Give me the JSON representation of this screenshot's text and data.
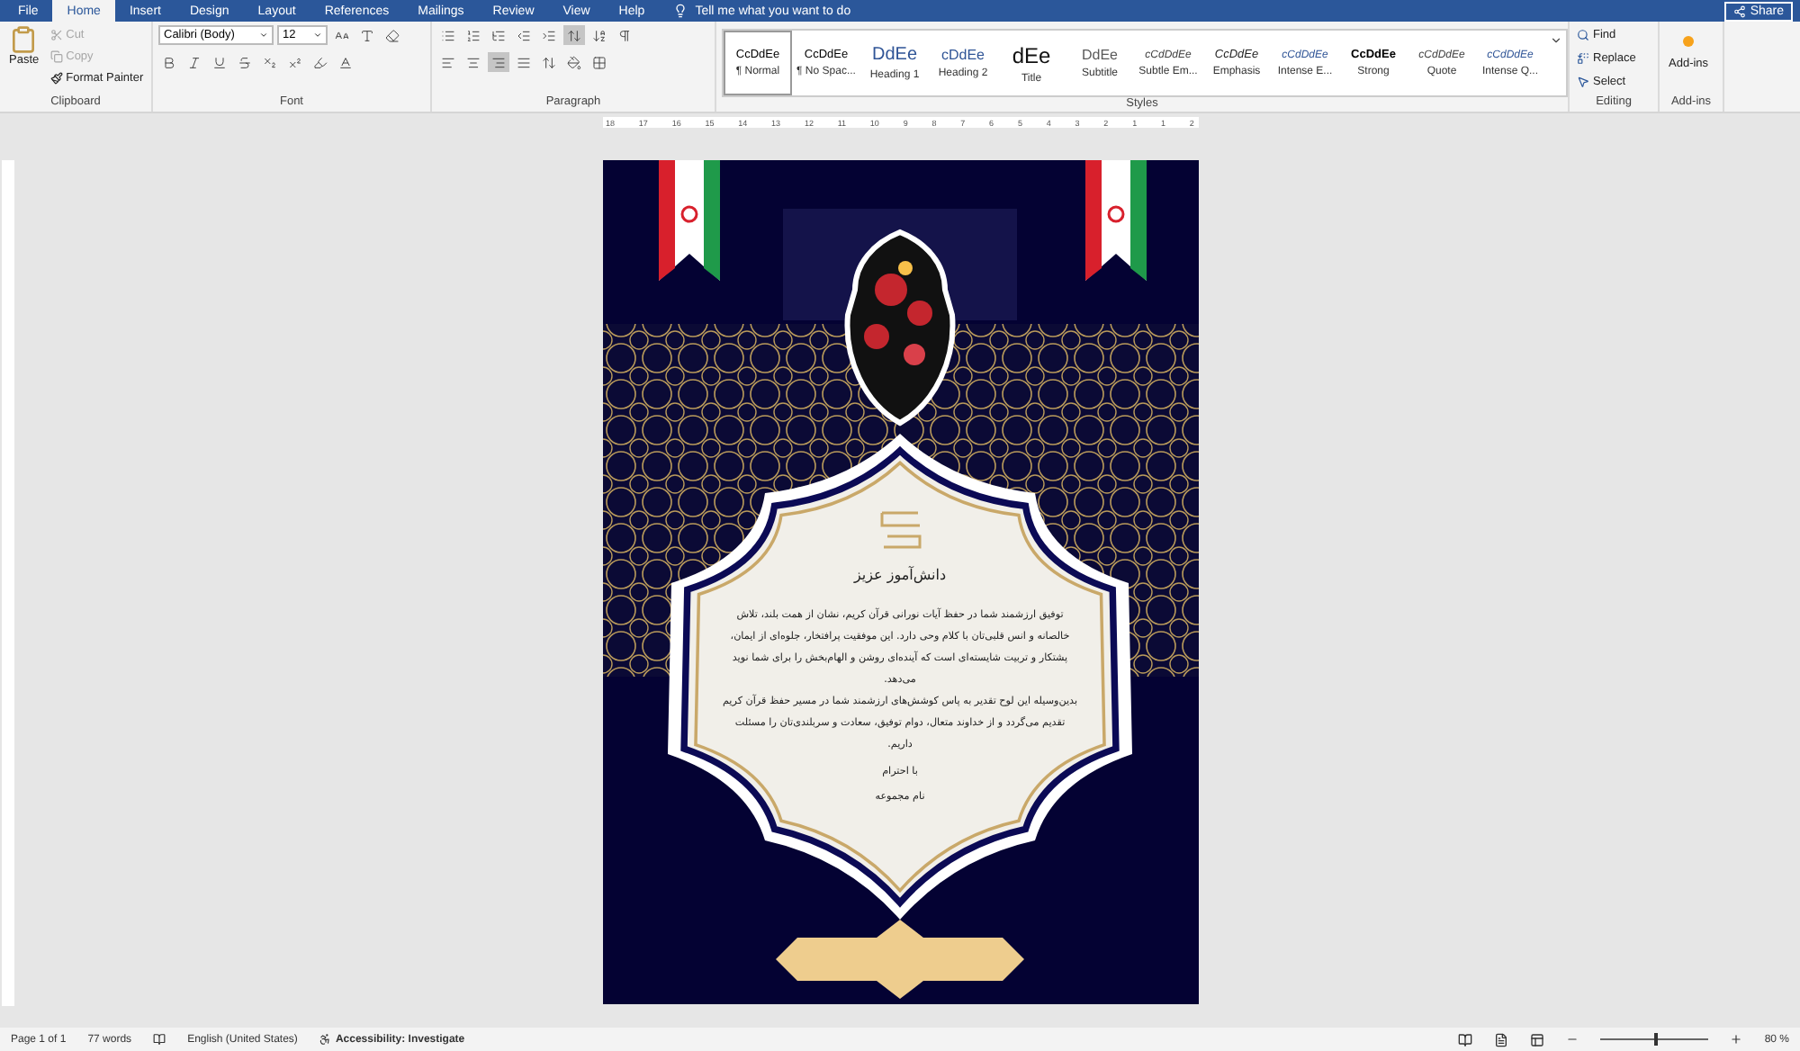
{
  "tabs": [
    {
      "label": "File",
      "selected": false
    },
    {
      "label": "Home",
      "selected": true
    },
    {
      "label": "Insert",
      "selected": false
    },
    {
      "label": "Design",
      "selected": false
    },
    {
      "label": "Layout",
      "selected": false
    },
    {
      "label": "References",
      "selected": false
    },
    {
      "label": "Mailings",
      "selected": false
    },
    {
      "label": "Review",
      "selected": false
    },
    {
      "label": "View",
      "selected": false
    },
    {
      "label": "Help",
      "selected": false
    }
  ],
  "tell_me": "Tell me what you want to do",
  "share": "Share",
  "clipboard": {
    "label": "Clipboard",
    "paste": "Paste",
    "items": [
      {
        "label": "Cut",
        "disabled": true
      },
      {
        "label": "Copy",
        "disabled": true
      },
      {
        "label": "Format Painter",
        "disabled": false
      }
    ]
  },
  "font": {
    "label": "Font",
    "name": "Calibri (Body)",
    "size": "12"
  },
  "paragraph": {
    "label": "Paragraph"
  },
  "styles": {
    "label": "Styles",
    "items": [
      {
        "preview": "CcDdEe",
        "name": "¶ Normal",
        "selected": true,
        "kind": "normal"
      },
      {
        "preview": "CcDdEe",
        "name": "¶ No Spac...",
        "selected": false,
        "kind": "normal"
      },
      {
        "preview": "DdEe",
        "name": "Heading 1",
        "selected": false,
        "kind": "heading1"
      },
      {
        "preview": "cDdEe",
        "name": "Heading 2",
        "selected": false,
        "kind": "heading2"
      },
      {
        "preview": "dEe",
        "name": "Title",
        "selected": false,
        "kind": "title"
      },
      {
        "preview": "DdEe",
        "name": "Subtitle",
        "selected": false,
        "kind": "subtitle"
      },
      {
        "preview": "cCdDdEe",
        "name": "Subtle Em...",
        "selected": false,
        "kind": "subtle"
      },
      {
        "preview": "CcDdEe",
        "name": "Emphasis",
        "selected": false,
        "kind": "emphasis"
      },
      {
        "preview": "cCdDdEe",
        "name": "Intense E...",
        "selected": false,
        "kind": "intense"
      },
      {
        "preview": "CcDdEe",
        "name": "Strong",
        "selected": false,
        "kind": "strong"
      },
      {
        "preview": "cCdDdEe",
        "name": "Quote",
        "selected": false,
        "kind": "quote"
      },
      {
        "preview": "cCdDdEe",
        "name": "Intense Q...",
        "selected": false,
        "kind": "intensequote"
      }
    ]
  },
  "editing": {
    "label": "Editing",
    "items": [
      "Find",
      "Replace",
      "Select"
    ]
  },
  "addins": {
    "button": "Add-ins",
    "label": "Add-ins"
  },
  "ruler_numbers": [
    "18",
    "17",
    "16",
    "15",
    "14",
    "13",
    "12",
    "11",
    "10",
    "9",
    "8",
    "7",
    "6",
    "5",
    "4",
    "3",
    "2",
    "1",
    "1",
    "2"
  ],
  "document": {
    "heading": "دانش‌آموز عزیز",
    "paragraphs": [
      "توفیق ارزشمند شما در حفظ آیات نورانی قرآن کریم، نشان از همت بلند، تلاش خالصانه و انس قلبی‌تان با کلام وحی دارد. این موفقیت پرافتخار، جلوه‌ای از ایمان، پشتکار و تربیت شایسته‌ای است که آینده‌ای روشن و الهام‌بخش را برای شما نوید می‌دهد.",
      "بدین‌وسیله این لوح تقدیر به پاس کوشش‌های ارزشمند شما در مسیر حفظ قرآن کریم تقدیم می‌گردد و از خداوند متعال، دوام توفیق، سعادت و سربلندی‌تان را مسئلت داریم."
    ],
    "closing": "با احترام",
    "signature": "نام مجموعه"
  },
  "status_bar": {
    "page": "Page 1 of 1",
    "words": "77 words",
    "language": "English (United States)",
    "accessibility": "Accessibility: Investigate",
    "zoom": {
      "level": 0.5,
      "reading": "80 %"
    }
  }
}
